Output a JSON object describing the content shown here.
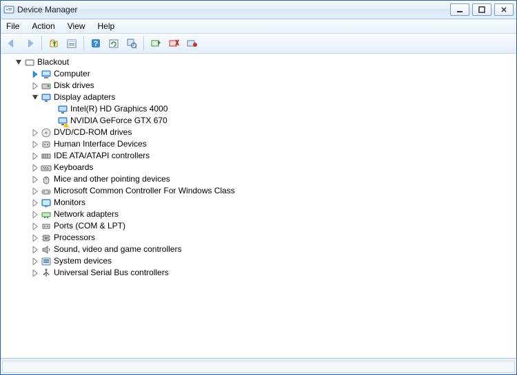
{
  "title": "Device Manager",
  "menus": {
    "file": "File",
    "action": "Action",
    "view": "View",
    "help": "Help"
  },
  "root": "Blackout",
  "categories": [
    {
      "label": "Computer",
      "icon": "computer",
      "expanded": false,
      "blueArrow": true
    },
    {
      "label": "Disk drives",
      "icon": "disk",
      "expanded": false
    },
    {
      "label": "Display adapters",
      "icon": "display",
      "expanded": true,
      "children": [
        {
          "label": "Intel(R) HD Graphics 4000",
          "icon": "display"
        },
        {
          "label": "NVIDIA GeForce GTX 670",
          "icon": "display",
          "warning": true
        }
      ]
    },
    {
      "label": "DVD/CD-ROM drives",
      "icon": "optical",
      "expanded": false
    },
    {
      "label": "Human Interface Devices",
      "icon": "hid",
      "expanded": false
    },
    {
      "label": "IDE ATA/ATAPI controllers",
      "icon": "ide",
      "expanded": false
    },
    {
      "label": "Keyboards",
      "icon": "keyboard",
      "expanded": false
    },
    {
      "label": "Mice and other pointing devices",
      "icon": "mouse",
      "expanded": false
    },
    {
      "label": "Microsoft Common Controller For Windows Class",
      "icon": "controller",
      "expanded": false
    },
    {
      "label": "Monitors",
      "icon": "monitor",
      "expanded": false
    },
    {
      "label": "Network adapters",
      "icon": "network",
      "expanded": false
    },
    {
      "label": "Ports (COM & LPT)",
      "icon": "port",
      "expanded": false
    },
    {
      "label": "Processors",
      "icon": "cpu",
      "expanded": false
    },
    {
      "label": "Sound, video and game controllers",
      "icon": "sound",
      "expanded": false
    },
    {
      "label": "System devices",
      "icon": "system",
      "expanded": false
    },
    {
      "label": "Universal Serial Bus controllers",
      "icon": "usb",
      "expanded": false
    }
  ]
}
